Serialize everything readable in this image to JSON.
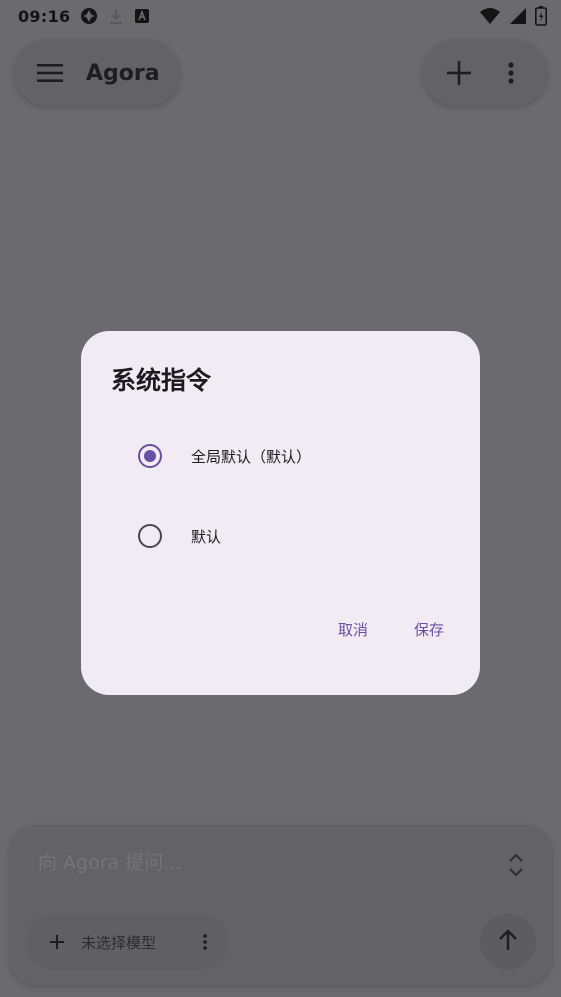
{
  "status_bar": {
    "time": "09:16",
    "icons_left": [
      "app-notification-icon",
      "download-icon",
      "font-a-icon"
    ],
    "icons_right": [
      "wifi-icon",
      "signal-icon",
      "battery-icon"
    ]
  },
  "app_bar": {
    "title": "Agora",
    "menu_icon": "hamburger-menu-icon",
    "actions": [
      "add-icon",
      "more-vert-icon"
    ]
  },
  "dialog": {
    "title": "系统指令",
    "options": [
      {
        "label": "全局默认（默认）",
        "selected": true
      },
      {
        "label": "默认",
        "selected": false
      }
    ],
    "cancel_label": "取消",
    "save_label": "保存"
  },
  "composer": {
    "placeholder": "向 Agora 提问...",
    "model_label": "未选择模型",
    "expand_icon": "unfold-icon",
    "send_icon": "arrow-up-icon"
  },
  "colors": {
    "scrim_background": "#6b6a6e",
    "dialog_surface": "#f1ecf4",
    "accent": "#6750a4"
  }
}
